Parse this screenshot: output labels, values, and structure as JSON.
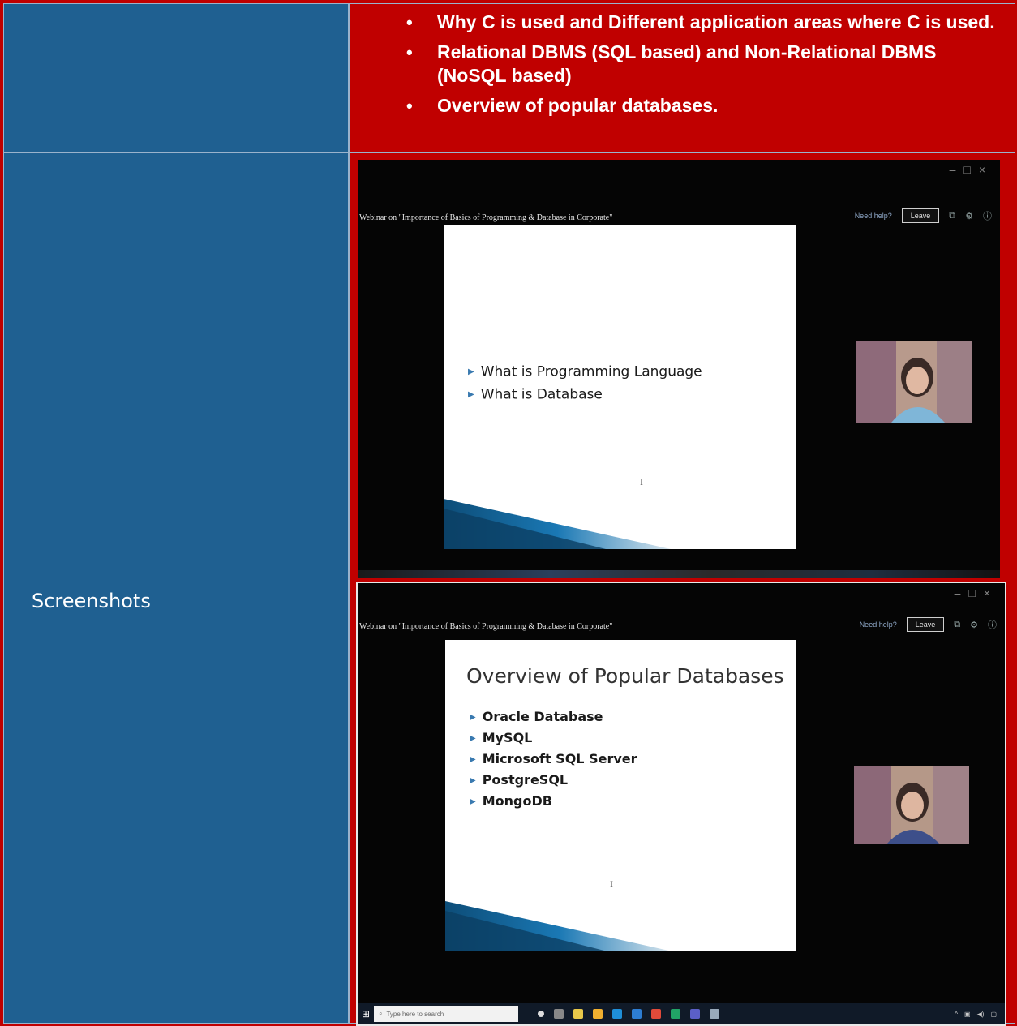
{
  "row1": {
    "bullets": [
      "Why C is used and Different application areas where C is used.",
      "Relational DBMS (SQL based) and Non-Relational DBMS (NoSQL based)",
      "Overview of popular databases."
    ]
  },
  "row2": {
    "label": "Screenshots"
  },
  "screenshot1": {
    "meeting_title": "Webinar on \"Importance of Basics of Programming & Database in Corporate\"",
    "need_help": "Need help?",
    "leave_label": "Leave",
    "slide_bullets": [
      "What is Programming Language",
      "What is Database"
    ]
  },
  "screenshot2": {
    "meeting_title": "Webinar on \"Importance of Basics of Programming & Database in Corporate\"",
    "need_help": "Need help?",
    "leave_label": "Leave",
    "slide_heading": "Overview of Popular Databases",
    "slide_bullets": [
      "Oracle Database",
      "MySQL",
      "Microsoft SQL Server",
      "PostgreSQL",
      "MongoDB"
    ],
    "taskbar": {
      "search_placeholder": "Type here to search"
    }
  },
  "colors": {
    "page_red": "#c00000",
    "cell_blue": "#1f6091",
    "slide_accent": "#1a78b4"
  }
}
